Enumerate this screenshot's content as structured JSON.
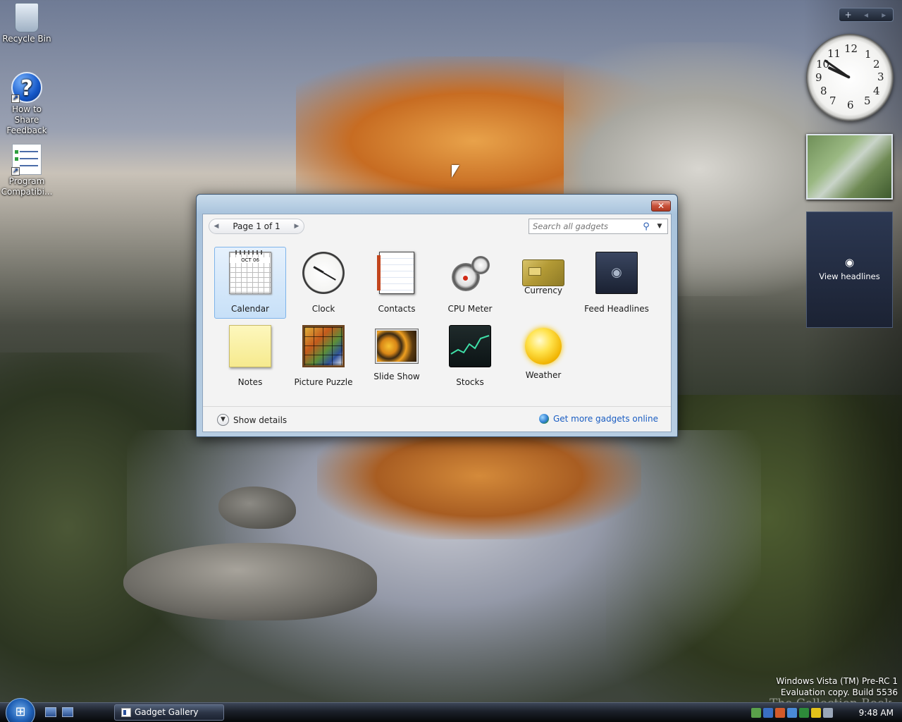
{
  "desktop": {
    "icons": [
      {
        "label": "Recycle Bin"
      },
      {
        "label": "How to Share Feedback"
      },
      {
        "label": "Program Compatibi..."
      }
    ],
    "version_line1": "Windows Vista (TM) Pre-RC 1",
    "version_line2": "Evaluation copy. Build 5536",
    "watermark": "The Collection Book"
  },
  "sidebar": {
    "controls": [
      "+",
      "◂",
      "▸"
    ],
    "clock_numbers": [
      "12",
      "1",
      "2",
      "3",
      "4",
      "5",
      "6",
      "7",
      "8",
      "9",
      "10",
      "11"
    ],
    "feed_label": "View headlines",
    "feed_icon": "rss-icon"
  },
  "gallery": {
    "window_title": "Gadget Gallery",
    "close_label": "✕",
    "page_label": "Page 1 of 1",
    "search_placeholder": "Search all gadgets",
    "gadgets": [
      {
        "label": "Calendar",
        "selected": true
      },
      {
        "label": "Clock"
      },
      {
        "label": "Contacts"
      },
      {
        "label": "CPU Meter"
      },
      {
        "label": "Currency"
      },
      {
        "label": "Feed Headlines"
      },
      {
        "label": "Notes"
      },
      {
        "label": "Picture Puzzle"
      },
      {
        "label": "Slide Show"
      },
      {
        "label": "Stocks"
      },
      {
        "label": "Weather"
      }
    ],
    "calendar_month": "OCT 06",
    "show_details": "Show details",
    "more_online": "Get more gadgets online"
  },
  "taskbar": {
    "task_label": "Gadget Gallery",
    "time": "9:48 AM"
  },
  "colors": {
    "accent": "#1a5dc2",
    "selection": "#c7e0f8",
    "close": "#c8513a"
  }
}
